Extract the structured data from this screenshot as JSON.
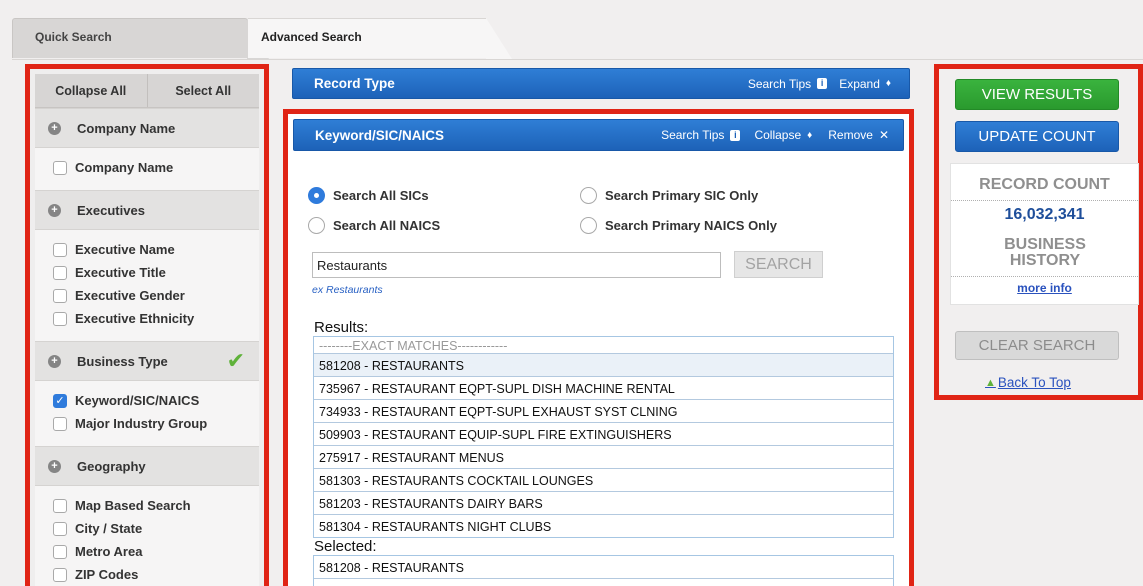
{
  "tabs": [
    {
      "label": "Quick Search",
      "active": false
    },
    {
      "label": "Advanced Search",
      "active": true
    }
  ],
  "sidebar": {
    "collapse_all": "Collapse All",
    "select_all": "Select All",
    "sections": [
      {
        "title": "Company Name",
        "checked_mark": false,
        "items": [
          {
            "label": "Company Name",
            "checked": false
          }
        ]
      },
      {
        "title": "Executives",
        "checked_mark": false,
        "items": [
          {
            "label": "Executive Name",
            "checked": false
          },
          {
            "label": "Executive Title",
            "checked": false
          },
          {
            "label": "Executive Gender",
            "checked": false
          },
          {
            "label": "Executive Ethnicity",
            "checked": false
          }
        ]
      },
      {
        "title": "Business Type",
        "checked_mark": true,
        "items": [
          {
            "label": "Keyword/SIC/NAICS",
            "checked": true
          },
          {
            "label": "Major Industry Group",
            "checked": false
          }
        ]
      },
      {
        "title": "Geography",
        "checked_mark": false,
        "items": [
          {
            "label": "Map Based Search",
            "checked": false
          },
          {
            "label": "City / State",
            "checked": false
          },
          {
            "label": "Metro Area",
            "checked": false
          },
          {
            "label": "ZIP Codes",
            "checked": false
          }
        ]
      }
    ]
  },
  "record_type": {
    "title": "Record Type",
    "search_tips": "Search Tips",
    "expand": "Expand"
  },
  "keyword_panel": {
    "title": "Keyword/SIC/NAICS",
    "search_tips": "Search Tips",
    "collapse": "Collapse",
    "remove": "Remove",
    "radios": [
      {
        "label": "Search All SICs",
        "selected": true
      },
      {
        "label": "Search Primary SIC Only",
        "selected": false
      },
      {
        "label": "Search All NAICS",
        "selected": false
      },
      {
        "label": "Search Primary NAICS Only",
        "selected": false
      }
    ],
    "search_value": "Restaurants",
    "search_button": "SEARCH",
    "example": "ex Restaurants",
    "results_label": "Results:",
    "results": [
      "--------EXACT MATCHES------------",
      "581208 - RESTAURANTS",
      "735967 - RESTAURANT EQPT-SUPL DISH MACHINE RENTAL",
      "734933 - RESTAURANT EQPT-SUPL EXHAUST SYST CLNING",
      "509903 - RESTAURANT EQUIP-SUPL FIRE EXTINGUISHERS",
      "275917 - RESTAURANT MENUS",
      "581303 - RESTAURANTS COCKTAIL LOUNGES",
      "581203 - RESTAURANTS DAIRY BARS",
      "581304 - RESTAURANTS NIGHT CLUBS"
    ],
    "selected_label": "Selected:",
    "selected": [
      "581208 - RESTAURANTS"
    ]
  },
  "right_panel": {
    "view_results": "VIEW RESULTS",
    "update_count": "UPDATE COUNT",
    "record_count_label": "RECORD COUNT",
    "record_count": "16,032,341",
    "business_history_label": "BUSINESS HISTORY",
    "more_info": "more info",
    "clear_search": "CLEAR SEARCH",
    "back_to_top": "Back To Top"
  },
  "colors": {
    "highlight_red": "#e02415",
    "bar_blue": "#1d62b8",
    "button_green": "#2a9a2e",
    "count_blue": "#1e4e9a"
  }
}
